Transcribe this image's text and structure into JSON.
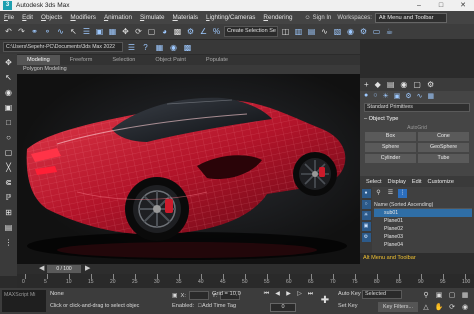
{
  "window": {
    "title": "Autodesk 3ds Max",
    "app_icon": "3"
  },
  "menu": {
    "items": [
      "File",
      "Edit",
      "Objects",
      "Modifiers",
      "Animation",
      "Simulate",
      "Materials",
      "Lighting/Cameras",
      "Rendering"
    ],
    "sign_in": "Sign In",
    "workspaces_label": "Workspaces:",
    "workspace_value": "Alt Menu and Toolbar"
  },
  "toolbar": {
    "selection_set_placeholder": "Create Selection Se"
  },
  "path_bar": {
    "path": "C:\\Users\\Sepehr-PC\\Documents\\3ds Max 2022"
  },
  "ribbon": {
    "tabs": [
      "Modeling",
      "Freeform",
      "Selection",
      "Object Paint",
      "Populate"
    ],
    "active_tab": "Modeling",
    "sub_label": "Polygon Modeling"
  },
  "command_panel": {
    "category_dropdown": "Standard Primitives",
    "rollout_title": "Object Type",
    "autogrid": "AutoGrid",
    "buttons": [
      "Box",
      "Cone",
      "Sphere",
      "GeoSphere",
      "Cylinder",
      "Tube"
    ]
  },
  "scene_explorer": {
    "tabs": [
      "Select",
      "Display",
      "Edit",
      "Customize"
    ],
    "column_header": "Name (Sorted Ascending)",
    "rows": [
      "sub01",
      "Plane01",
      "Plane02",
      "Plane03",
      "Plane04"
    ]
  },
  "alt_menu_label": "Alt Menu and Toolbar",
  "timeline": {
    "slider_label": "0 / 100",
    "ticks": [
      "0",
      "5",
      "10",
      "15",
      "20",
      "25",
      "30",
      "35",
      "40",
      "45",
      "50",
      "55",
      "60",
      "65",
      "70",
      "75",
      "80",
      "85",
      "90",
      "95",
      "100"
    ]
  },
  "status": {
    "maxscript_label": "MAXScript Mi",
    "selection_text": "None",
    "hint": "Click or click-and-drag to select objec",
    "x_label": "X:",
    "y_label": "Y:",
    "enabled_label": "Enabled:",
    "grid_label": "Grid = 10,0",
    "add_time_tag": "Add Time Tag",
    "frame_value": "0",
    "auto_key": "Auto Key",
    "set_key": "Set Key",
    "selected_dropdown": "Selected",
    "key_filters": "Key Filters..."
  },
  "icons": {
    "accent": "#9ec9ff",
    "highlight_yellow": "#f1c232",
    "selection_blue": "#2f6ea6",
    "car_red": "#c0182c"
  }
}
